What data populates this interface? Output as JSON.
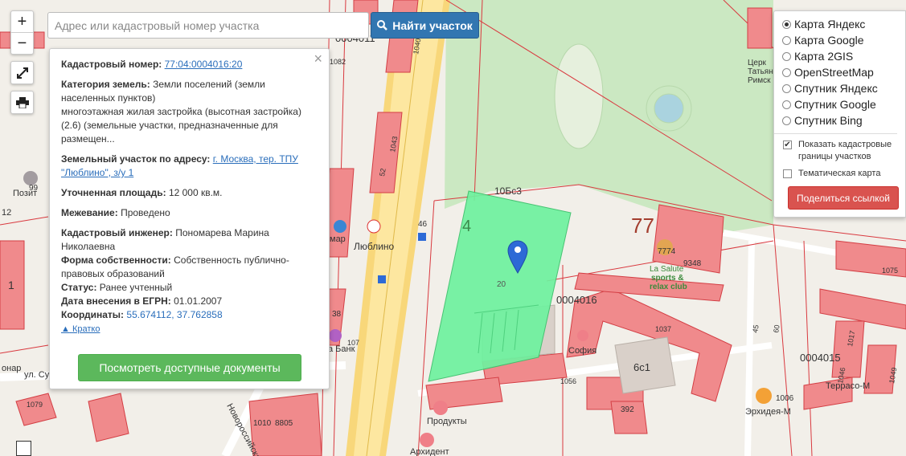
{
  "search": {
    "placeholder": "Адрес или кадастровый номер участка",
    "button_label": "Найти участок"
  },
  "zoom": {
    "in": "+",
    "out": "−"
  },
  "info": {
    "cadastral_label": "Кадастровый номер:",
    "cadastral_value": "77:04:0004016:20",
    "category_label": "Категория земель:",
    "category_value": "Земли поселений (земли населенных пунктов)",
    "category_desc": "многоэтажная жилая застройка (высотная застройка) (2.6) (земельные участки, предназначенные для размещен...",
    "address_label": "Земельный участок по адресу:",
    "address_value": "г. Москва, тер. ТПУ \"Люблино\", з/у 1",
    "area_label": "Уточненная площадь:",
    "area_value": "12 000 кв.м.",
    "survey_label": "Межевание:",
    "survey_value": "Проведено",
    "engineer_label": "Кадастровый инженер:",
    "engineer_value": "Пономарева Марина Николаевна",
    "ownership_label": "Форма собственности:",
    "ownership_value": "Собственность публично-правовых образований",
    "status_label": "Статус:",
    "status_value": "Ранее учтенный",
    "date_label": "Дата внесения в ЕГРН:",
    "date_value": "01.01.2007",
    "coords_label": "Координаты:",
    "coords_value": "55.674112, 37.762858",
    "brief_label": "Кратко",
    "docs_button": "Посмотреть доступные документы",
    "close": "×"
  },
  "layers": {
    "options": [
      "Карта Яндекс",
      "Карта Google",
      "Карта 2GIS",
      "OpenStreetMap",
      "Спутник Яндекс",
      "Спутник Google",
      "Спутник Bing"
    ],
    "selected": "Карта Яндекс",
    "show_cadastral": "Показать кадастровые границы участков",
    "show_cadastral_checked": true,
    "thematic": "Тематическая карта",
    "thematic_checked": false,
    "share_button": "Поделиться ссылкой"
  },
  "map": {
    "highlight_color": "#6ef29f",
    "labels": {
      "block_4": "4",
      "block_77": "77",
      "b10bs3": "10Бс3",
      "parcel_20": "20",
      "q4016": "0004016",
      "q4015": "0004015",
      "q4011": "0004011",
      "b6c1": "6с1",
      "sofia": "София",
      "produkty": "Продукты",
      "arkhident": "Архидент",
      "lyublino": "Люблино",
      "sport1": "La Salute",
      "sport2": "sports &",
      "sport3": "relax club",
      "b7774": "7774",
      "b9348": "9348",
      "b1006": "1006",
      "erkhidei": "Эрхидея-М",
      "terraso": "Террасо-М",
      "b1056": "1056",
      "b1037": "1037",
      "b392": "392",
      "b1010": "1010",
      "b8805": "8805",
      "b1079": "1079",
      "novoross": "Новороссийская",
      "ul_su": "ул. Су",
      "pozit": "Позит",
      "mar": "мар",
      "bank": "а Банк",
      "nar": "онар",
      "b1043": "1043",
      "b1082": "1082",
      "b107": "107",
      "b38": "38",
      "b46": "46",
      "b52": "52",
      "b1075": "1075",
      "b1049": "1049",
      "church1": "Церк",
      "church2": "Татьян",
      "church3": "Римск",
      "b1017": "1017",
      "b1046": "1046",
      "b60": "60",
      "b45": "45",
      "b1040": "1040",
      "b99": "99",
      "b12": "12",
      "b1": "1"
    }
  }
}
